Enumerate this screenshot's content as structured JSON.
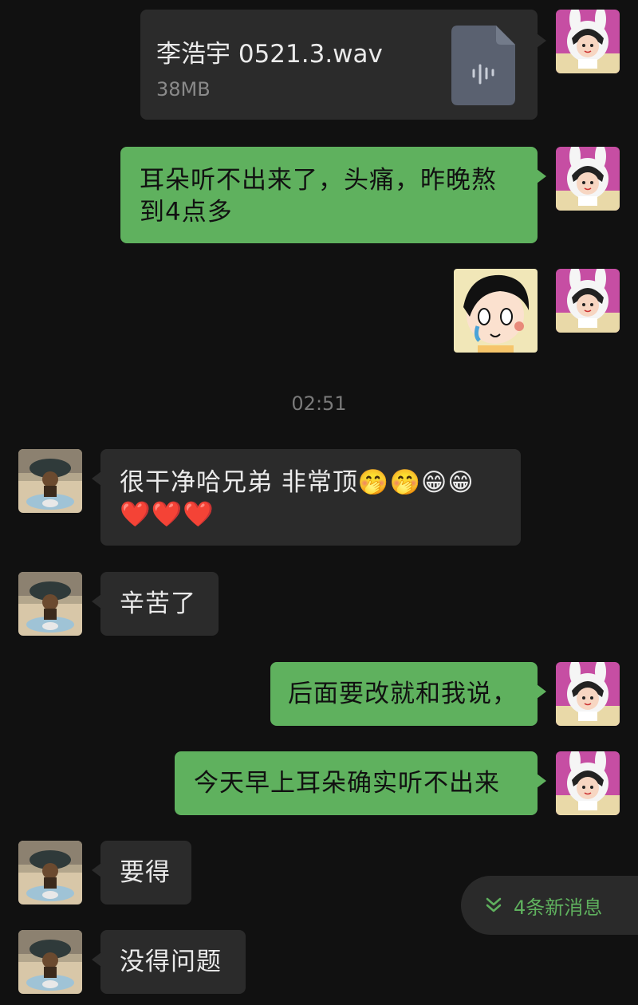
{
  "file": {
    "name": "李浩宇 0521.3.wav",
    "size": "38MB",
    "icon": "audio-file-icon"
  },
  "messages": [
    {
      "text": "耳朵听不出来了，头痛，昨晚熬到4点多"
    },
    {
      "text": "很干净哈兄弟 非常顶🤭🤭😁😁❤️❤️❤️"
    },
    {
      "text": "辛苦了"
    },
    {
      "text": "后面要改就和我说，"
    },
    {
      "text": "今天早上耳朵确实听不出来"
    },
    {
      "text": "要得"
    },
    {
      "text": "没得问题"
    }
  ],
  "timestamp": "02:51",
  "new_messages": {
    "label": "4条新消息",
    "icon": "double-chevron-down-icon"
  },
  "colors": {
    "background": "#111111",
    "sent_bubble": "#5fb15e",
    "received_bubble": "#2b2b2b",
    "accent": "#5fb15e"
  }
}
